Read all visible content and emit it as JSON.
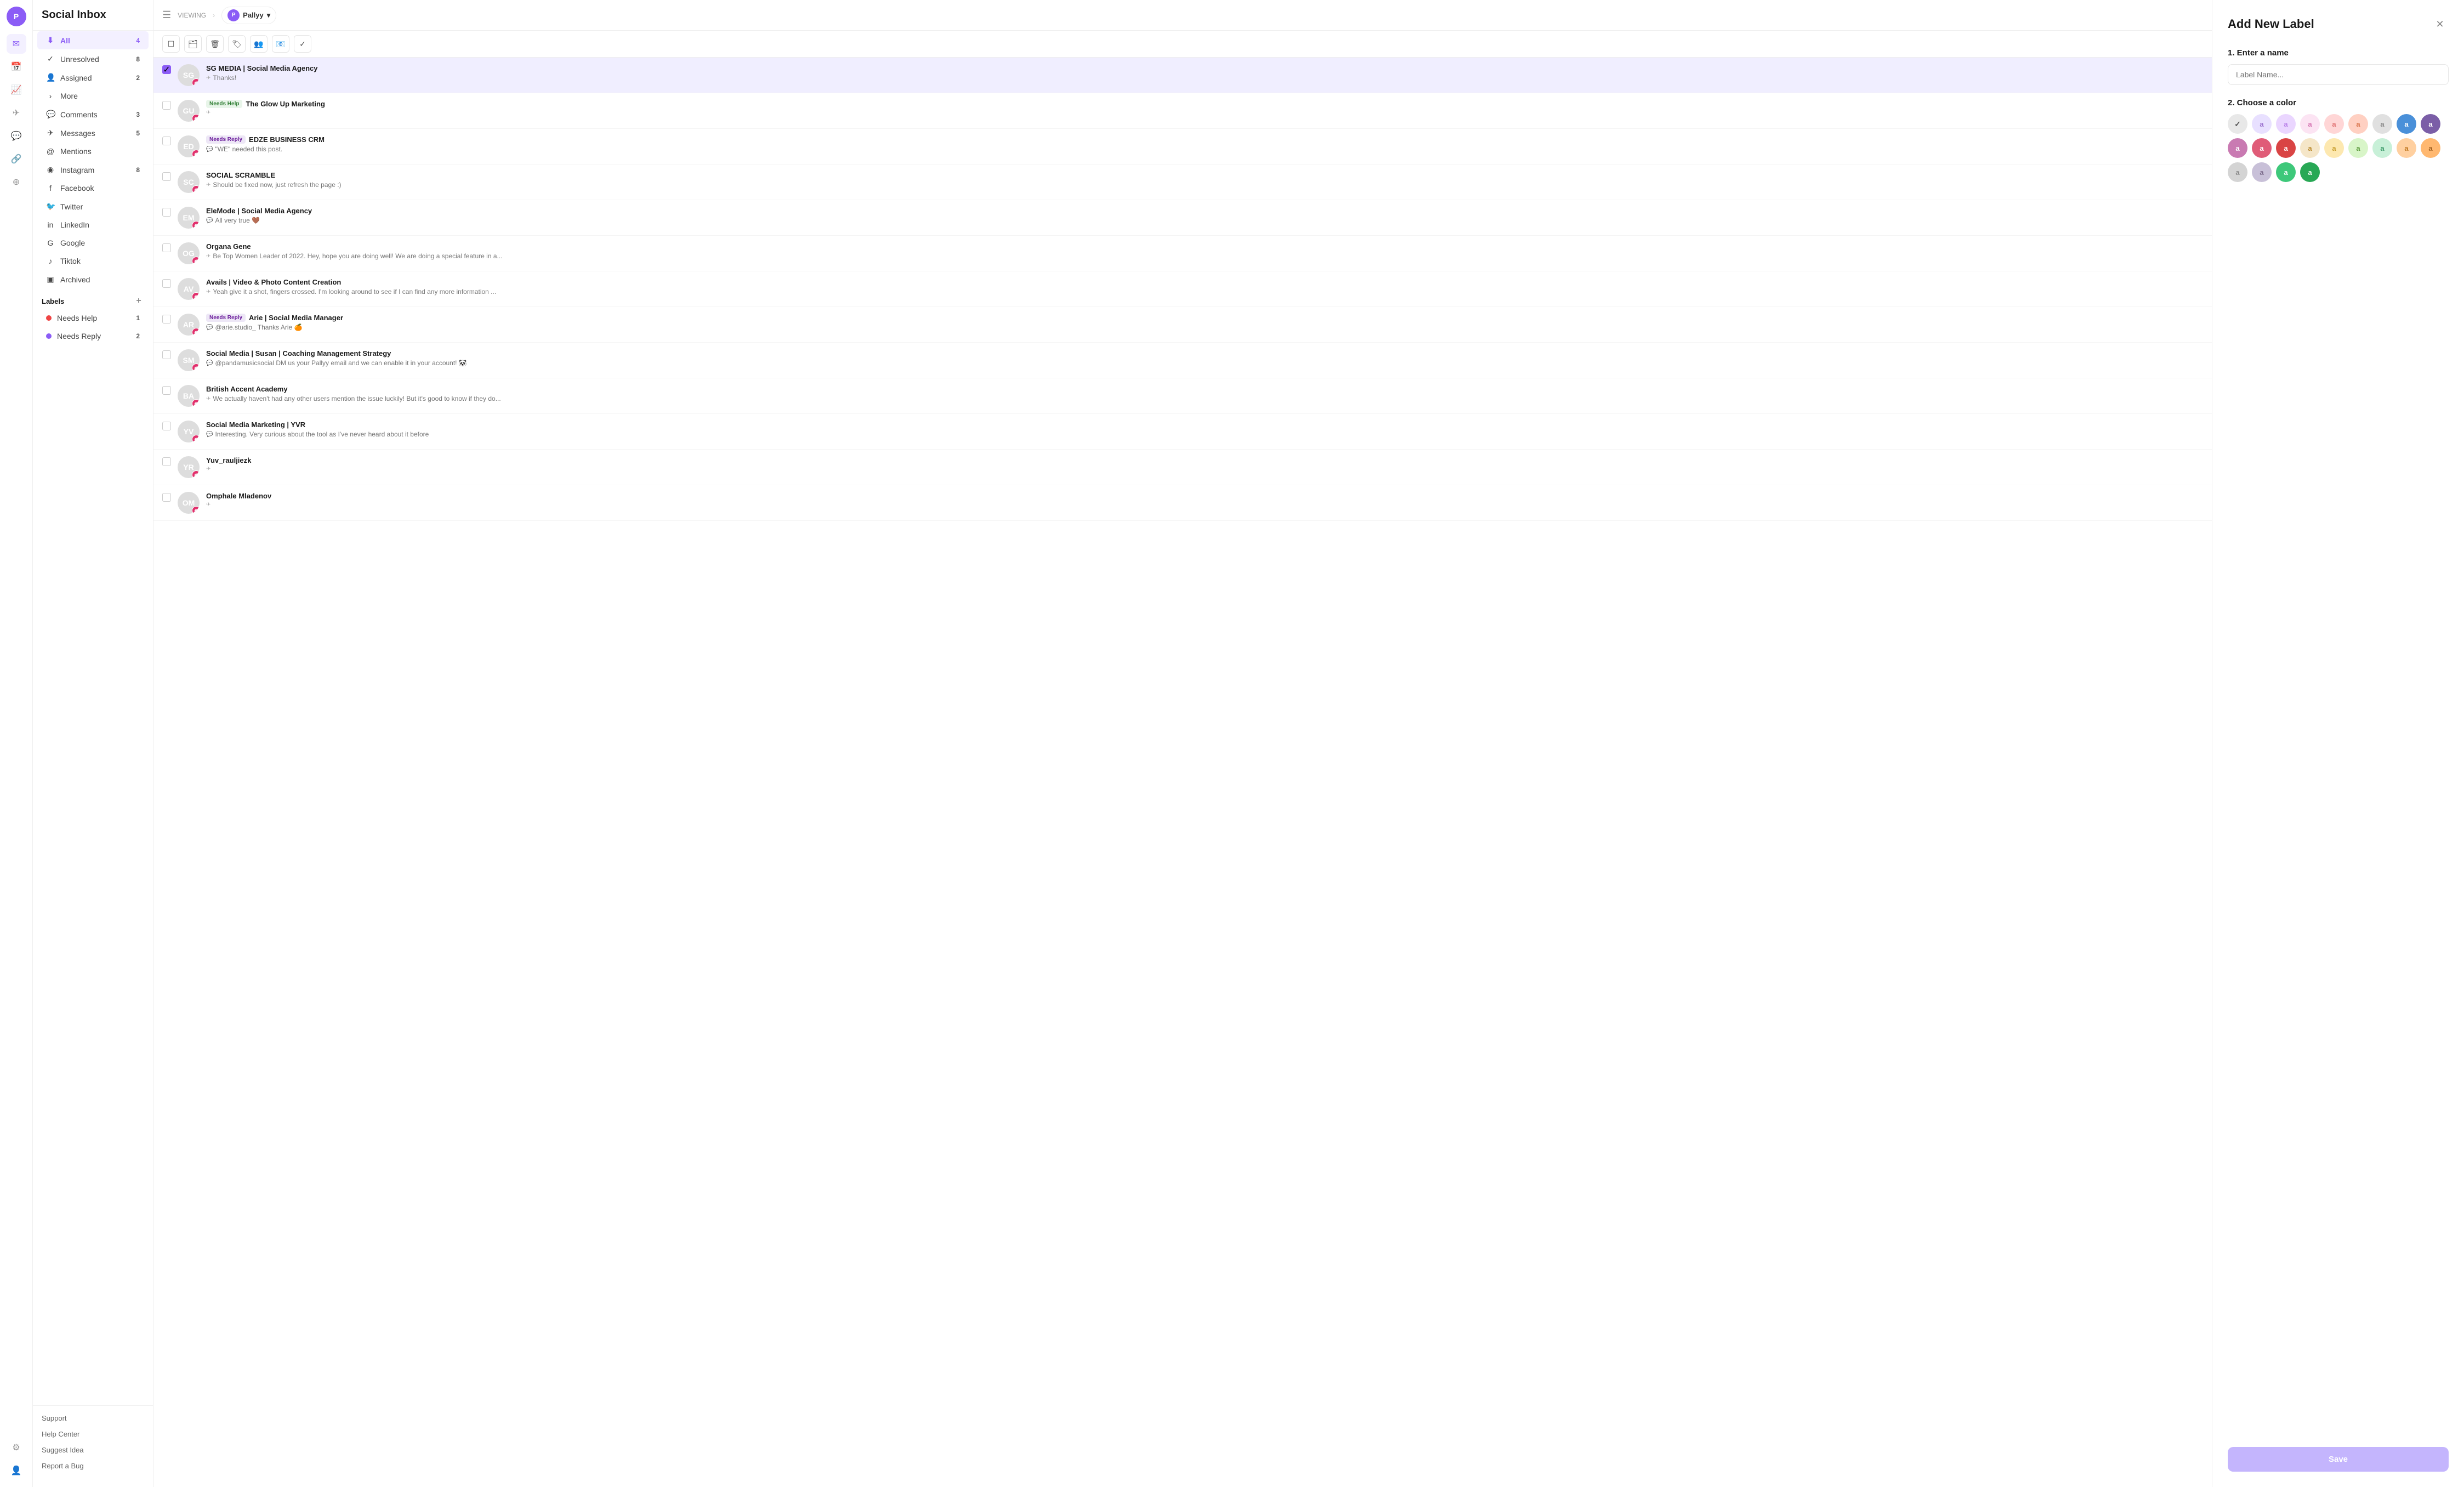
{
  "app": {
    "title": "Social Inbox",
    "logo": "P"
  },
  "topbar": {
    "viewing_label": "VIEWING",
    "workspace_name": "Pallyy",
    "workspace_initial": "P"
  },
  "sidebar": {
    "nav_items": [
      {
        "id": "all",
        "label": "All",
        "icon": "⬇",
        "badge": "4",
        "active": true
      },
      {
        "id": "unresolved",
        "label": "Unresolved",
        "icon": "✓",
        "badge": "8",
        "active": false
      },
      {
        "id": "assigned",
        "label": "Assigned",
        "icon": "👤",
        "badge": "2",
        "active": false
      },
      {
        "id": "more",
        "label": "More",
        "icon": "›",
        "badge": "",
        "active": false
      },
      {
        "id": "comments",
        "label": "Comments",
        "icon": "💬",
        "badge": "3",
        "active": false
      },
      {
        "id": "messages",
        "label": "Messages",
        "icon": "✈",
        "badge": "5",
        "active": false
      },
      {
        "id": "mentions",
        "label": "Mentions",
        "icon": "@",
        "badge": "",
        "active": false
      },
      {
        "id": "instagram",
        "label": "Instagram",
        "icon": "◉",
        "badge": "8",
        "active": false
      },
      {
        "id": "facebook",
        "label": "Facebook",
        "icon": "f",
        "badge": "",
        "active": false
      },
      {
        "id": "twitter",
        "label": "Twitter",
        "icon": "🐦",
        "badge": "",
        "active": false
      },
      {
        "id": "linkedin",
        "label": "LinkedIn",
        "icon": "in",
        "badge": "",
        "active": false
      },
      {
        "id": "google",
        "label": "Google",
        "icon": "G",
        "badge": "",
        "active": false
      },
      {
        "id": "tiktok",
        "label": "Tiktok",
        "icon": "♪",
        "badge": "",
        "active": false
      },
      {
        "id": "archived",
        "label": "Archived",
        "icon": "▣",
        "badge": "",
        "active": false
      }
    ],
    "labels_section": "Labels",
    "labels": [
      {
        "id": "needs-help",
        "label": "Needs Help",
        "badge": "1",
        "color": "#ef4444"
      },
      {
        "id": "needs-reply",
        "label": "Needs Reply",
        "badge": "2",
        "color": "#8b5cf6"
      }
    ],
    "footer_links": [
      "Support",
      "Help Center",
      "Suggest Idea",
      "Report a Bug"
    ]
  },
  "toolbar": {
    "icons": [
      "☰",
      "🗑",
      "🗑",
      "🏷",
      "👥",
      "📧",
      "✓"
    ]
  },
  "messages": [
    {
      "id": 1,
      "name": "SG MEDIA | Social Media Agency",
      "tag": null,
      "preview": "Thanks!",
      "platform": "instagram",
      "msg_type": "dm",
      "avatar_text": "SG",
      "avatar_color": "av-purple",
      "selected": true
    },
    {
      "id": 2,
      "name": "The Glow Up Marketing",
      "tag": "Needs Help",
      "tag_class": "tag-needs-help",
      "preview": "",
      "platform": "instagram",
      "msg_type": "dm",
      "avatar_text": "GU",
      "avatar_color": "av-pink"
    },
    {
      "id": 3,
      "name": "EDZE BUSINESS CRM",
      "tag": "Needs Reply",
      "tag_class": "tag-needs-reply",
      "preview": "\"WE\" needed this post.",
      "platform": "instagram",
      "msg_type": "comment",
      "avatar_text": "ED",
      "avatar_color": "av-blue"
    },
    {
      "id": 4,
      "name": "SOCIAL SCRAMBLE",
      "tag": null,
      "preview": "Should be fixed now, just refresh the page :)",
      "platform": "instagram",
      "msg_type": "dm",
      "avatar_text": "SC",
      "avatar_color": "av-teal"
    },
    {
      "id": 5,
      "name": "EleMode | Social Media Agency",
      "tag": null,
      "preview": "All very true 🤎",
      "platform": "instagram",
      "msg_type": "comment",
      "avatar_text": "EM",
      "avatar_color": "av-gray"
    },
    {
      "id": 6,
      "name": "Organa Gene",
      "tag": null,
      "preview": "Be Top Women Leader of 2022. Hey, hope you are doing well! We are doing a special feature in a...",
      "platform": "instagram",
      "msg_type": "dm",
      "avatar_text": "OG",
      "avatar_color": "av-orange"
    },
    {
      "id": 7,
      "name": "Avails | Video & Photo Content Creation",
      "tag": null,
      "preview": "Yeah give it a shot, fingers crossed. I'm looking around to see if I can find any more information ...",
      "platform": "instagram",
      "msg_type": "dm",
      "avatar_text": "AV",
      "avatar_color": "av-green"
    },
    {
      "id": 8,
      "name": "Arie | Social Media Manager",
      "tag": "Needs Reply",
      "tag_class": "tag-needs-reply",
      "preview": "@arie.studio_ Thanks Arie 🍊",
      "platform": "instagram",
      "msg_type": "comment",
      "avatar_text": "AR",
      "avatar_color": "av-red"
    },
    {
      "id": 9,
      "name": "Social Media | Susan | Coaching Management Strategy",
      "tag": null,
      "preview": "@pandamusicsocial DM us your Pallyy email and we can enable it in your account! 🐼",
      "platform": "instagram",
      "msg_type": "comment",
      "avatar_text": "SM",
      "avatar_color": "av-purple"
    },
    {
      "id": 10,
      "name": "British Accent Academy",
      "tag": null,
      "preview": "We actually haven't had any other users mention the issue luckily! But it's good to know if they do...",
      "platform": "instagram",
      "msg_type": "dm",
      "avatar_text": "BA",
      "avatar_color": "av-dark"
    },
    {
      "id": 11,
      "name": "Social Media Marketing | YVR",
      "tag": null,
      "preview": "Interesting. Very curious about the tool as I've never heard about it before",
      "platform": "instagram",
      "msg_type": "comment",
      "avatar_text": "YV",
      "avatar_color": "av-yellow"
    },
    {
      "id": 12,
      "name": "Yuv_rauljiezk",
      "tag": null,
      "preview": "",
      "platform": "instagram",
      "msg_type": "dm",
      "avatar_text": "YR",
      "avatar_color": "av-light"
    },
    {
      "id": 13,
      "name": "Omphale Mladenov",
      "tag": null,
      "preview": "",
      "platform": "instagram",
      "msg_type": "dm",
      "avatar_text": "OM",
      "avatar_color": "av-blue"
    }
  ],
  "add_label_panel": {
    "title": "Add New Label",
    "step1": "1. Enter a name",
    "input_placeholder": "Label Name...",
    "step2": "2. Choose a color",
    "save_button": "Save",
    "colors": [
      {
        "id": "c1",
        "bg": "#e8e8e8",
        "text": "#aaa",
        "selected": true
      },
      {
        "id": "c2",
        "bg": "#e8e0ff",
        "text": "#9b72cf"
      },
      {
        "id": "c3",
        "bg": "#ead6ff",
        "text": "#b87fe8"
      },
      {
        "id": "c4",
        "bg": "#fce4f3",
        "text": "#d472b0"
      },
      {
        "id": "c5",
        "bg": "#ffd6d6",
        "text": "#e07070"
      },
      {
        "id": "c6",
        "bg": "#ffd0c2",
        "text": "#d9734a"
      },
      {
        "id": "c7",
        "bg": "#e0e0e0",
        "text": "#888"
      },
      {
        "id": "c8",
        "bg": "#4a90d9",
        "text": "#fff"
      },
      {
        "id": "c9",
        "bg": "#7b5ea7",
        "text": "#fff"
      },
      {
        "id": "c10",
        "bg": "#c97ab2",
        "text": "#fff"
      },
      {
        "id": "c11",
        "bg": "#e05c78",
        "text": "#fff"
      },
      {
        "id": "c12",
        "bg": "#d94444",
        "text": "#fff"
      },
      {
        "id": "c13",
        "bg": "#f5e6c8",
        "text": "#b8882a"
      },
      {
        "id": "c14",
        "bg": "#fde8b0",
        "text": "#c79c2a"
      },
      {
        "id": "c15",
        "bg": "#d8f5c8",
        "text": "#5a9a3a"
      },
      {
        "id": "c16",
        "bg": "#c8f0d8",
        "text": "#3a9a68"
      },
      {
        "id": "c17",
        "bg": "#ffd0a0",
        "text": "#c07820"
      },
      {
        "id": "c18",
        "bg": "#ffb870",
        "text": "#a06020"
      },
      {
        "id": "c19",
        "bg": "#d4d4d4",
        "text": "#888"
      },
      {
        "id": "c20",
        "bg": "#c8c0d8",
        "text": "#7a6a8a"
      },
      {
        "id": "c21",
        "bg": "#3ec87a",
        "text": "#fff"
      },
      {
        "id": "c22",
        "bg": "#28a855",
        "text": "#fff"
      }
    ]
  }
}
